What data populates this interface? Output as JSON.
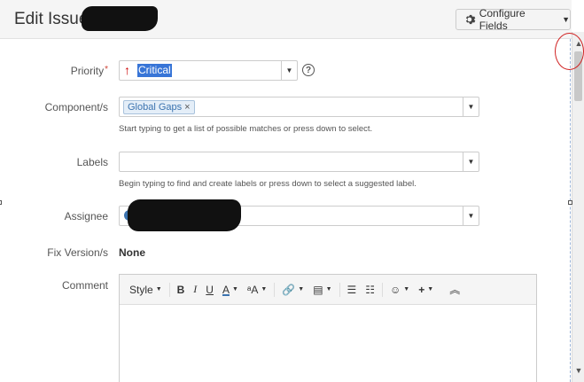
{
  "dialog": {
    "title": "Edit Issue :",
    "configure_label": "Configure Fields"
  },
  "fields": {
    "priority": {
      "label": "Priority",
      "required_mark": "*",
      "value": "Critical",
      "help": "?"
    },
    "components": {
      "label": "Component/s",
      "tag": "Global Gaps",
      "tag_remove": "×",
      "hint": "Start typing to get a list of possible matches or press down to select."
    },
    "labels": {
      "label": "Labels",
      "hint": "Begin typing to find and create labels or press down to select a suggested label."
    },
    "assignee": {
      "label": "Assignee"
    },
    "fix_version": {
      "label": "Fix Version/s",
      "value": "None"
    },
    "comment": {
      "label": "Comment"
    }
  },
  "toolbar": {
    "style": "Style",
    "bold": "B",
    "italic": "I",
    "underline": "U",
    "text_color": "A",
    "more_formatting": "ᵃA",
    "link": "🔗",
    "attachment": "▤",
    "bullet_list": "☰",
    "numbered_list": "☷",
    "emoticon": "☺",
    "insert": "+",
    "collapse": "︽"
  },
  "colors": {
    "accent": "#3b73af",
    "required": "#d04437",
    "priority_critical": "#cc0000",
    "selection": "#3875d7",
    "annotation": "#d02020"
  },
  "icons": {
    "gear": "gear-icon",
    "priority": "arrow-up-icon",
    "help": "question-circle-icon"
  }
}
